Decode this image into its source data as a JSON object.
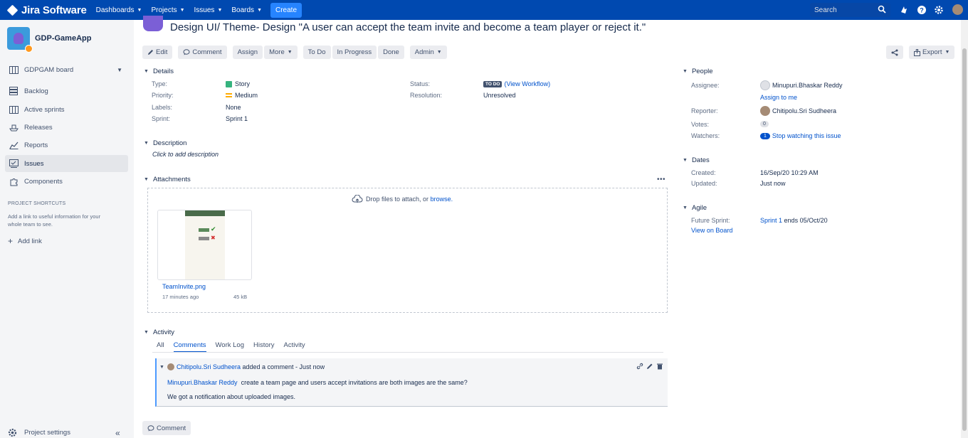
{
  "topbar": {
    "product": "Jira Software",
    "nav": [
      "Dashboards",
      "Projects",
      "Issues",
      "Boards"
    ],
    "create_label": "Create",
    "search_placeholder": "Search"
  },
  "sidebar": {
    "project_name": "GDP-GameApp",
    "board": "GDPGAM board",
    "items": [
      {
        "label": "Backlog",
        "icon": "backlog-icon"
      },
      {
        "label": "Active sprints",
        "icon": "board-icon"
      },
      {
        "label": "Releases",
        "icon": "ship-icon"
      },
      {
        "label": "Reports",
        "icon": "chart-icon"
      },
      {
        "label": "Issues",
        "icon": "issues-icon"
      },
      {
        "label": "Components",
        "icon": "puzzle-icon"
      }
    ],
    "shortcuts_title": "PROJECT SHORTCUTS",
    "shortcuts_text": "Add a link to useful information for your whole team to see.",
    "add_link": "Add link",
    "settings": "Project settings"
  },
  "issue": {
    "title": "Design UI/ Theme- Design \"A user can accept the team invite and become a team player or reject it.\"",
    "toolbar": {
      "edit": "Edit",
      "comment": "Comment",
      "assign": "Assign",
      "more": "More",
      "todo": "To Do",
      "in_progress": "In Progress",
      "done": "Done",
      "admin": "Admin",
      "export": "Export"
    },
    "details": {
      "heading": "Details",
      "type_label": "Type:",
      "type": "Story",
      "priority_label": "Priority:",
      "priority": "Medium",
      "labels_label": "Labels:",
      "labels": "None",
      "sprint_label": "Sprint:",
      "sprint": "Sprint 1",
      "status_label": "Status:",
      "status": "TO DO",
      "view_workflow": "(View Workflow)",
      "resolution_label": "Resolution:",
      "resolution": "Unresolved"
    },
    "description": {
      "heading": "Description",
      "hint": "Click to add description"
    },
    "attachments": {
      "heading": "Attachments",
      "drop_text": "Drop files to attach, or",
      "browse": "browse.",
      "file": {
        "name": "TeamInvite.png",
        "age": "17 minutes ago",
        "size": "45 kB"
      }
    },
    "activity": {
      "heading": "Activity",
      "tabs": [
        "All",
        "Comments",
        "Work Log",
        "History",
        "Activity"
      ],
      "active_tab": "Comments",
      "comment": {
        "author": "Chitipolu.Sri Sudheera",
        "action": "added a comment - Just now",
        "mention": "Minupuri.Bhaskar Reddy",
        "line1": "create a team page and users accept invitations are both images are the same?",
        "line2": "We got a notification about uploaded images."
      },
      "comment_button": "Comment"
    }
  },
  "right_panel": {
    "people": {
      "heading": "People",
      "assignee_label": "Assignee:",
      "assignee": "Minupuri.Bhaskar Reddy",
      "assign_to_me": "Assign to me",
      "reporter_label": "Reporter:",
      "reporter": "Chitipolu.Sri Sudheera",
      "votes_label": "Votes:",
      "votes": "0",
      "watchers_label": "Watchers:",
      "watchers": "1",
      "stop_watching": "Stop watching this issue"
    },
    "dates": {
      "heading": "Dates",
      "created_label": "Created:",
      "created": "16/Sep/20 10:29 AM",
      "updated_label": "Updated:",
      "updated": "Just now"
    },
    "agile": {
      "heading": "Agile",
      "future_sprint_label": "Future Sprint:",
      "sprint_link": "Sprint 1",
      "sprint_end": "ends 05/Oct/20",
      "view_on_board": "View on Board"
    }
  },
  "colors": {
    "topbar": "#0049b0",
    "link": "#0052cc",
    "create": "#2684ff",
    "story": "#36b37e",
    "medium": "#ffab00"
  }
}
